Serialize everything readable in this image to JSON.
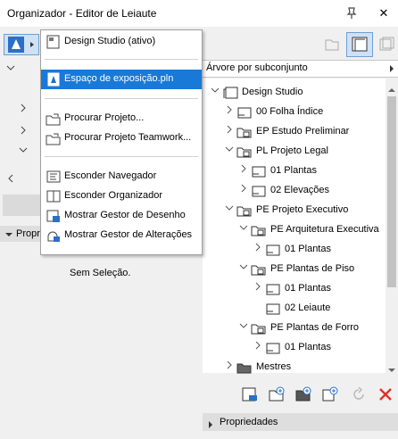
{
  "window": {
    "title": "Organizador - Editor de Leiaute",
    "close_glyph": "✕"
  },
  "menu": {
    "items": [
      {
        "label": "Design Studio (ativo)",
        "icon": "project-icon"
      },
      {
        "label": "Espaço de exposição.pln",
        "icon": "pln-file-icon",
        "selected": true
      },
      {
        "label": "Procurar Projeto...",
        "icon": "open-project-icon"
      },
      {
        "label": "Procurar Projeto Teamwork...",
        "icon": "open-teamwork-icon"
      },
      {
        "label": "Esconder Navegador",
        "icon": "navigator-icon"
      },
      {
        "label": "Esconder Organizador",
        "icon": "organizer-icon"
      },
      {
        "label": "Mostrar Gestor de Desenho",
        "icon": "drawing-manager-icon"
      },
      {
        "label": "Mostrar Gestor de Alterações",
        "icon": "change-manager-icon"
      }
    ]
  },
  "left_panel": {
    "properties_label": "Propr",
    "no_selection": "Sem Seleção."
  },
  "right_panel": {
    "tree_header": "Árvore por subconjunto",
    "tree": [
      {
        "label": "Design Studio",
        "depth": 0,
        "arrow": "down",
        "icon": "layout-book-icon"
      },
      {
        "label": "00 Folha Índice",
        "depth": 1,
        "arrow": "right",
        "icon": "layout-icon"
      },
      {
        "label": "EP Estudo Preliminar",
        "depth": 1,
        "arrow": "right",
        "icon": "subset-folder-icon"
      },
      {
        "label": "PL Projeto Legal",
        "depth": 1,
        "arrow": "down",
        "icon": "subset-folder-icon"
      },
      {
        "label": "01 Plantas",
        "depth": 2,
        "arrow": "right",
        "icon": "layout-icon"
      },
      {
        "label": "02 Elevações",
        "depth": 2,
        "arrow": "right",
        "icon": "layout-icon"
      },
      {
        "label": "PE Projeto Executivo",
        "depth": 1,
        "arrow": "down",
        "icon": "subset-folder-icon"
      },
      {
        "label": "PE Arquitetura Executiva",
        "depth": 2,
        "arrow": "down",
        "icon": "subset-folder-icon"
      },
      {
        "label": "01 Plantas",
        "depth": 3,
        "arrow": "right",
        "icon": "layout-icon"
      },
      {
        "label": "PE Plantas de Piso",
        "depth": 2,
        "arrow": "down",
        "icon": "subset-folder-icon"
      },
      {
        "label": "01 Plantas",
        "depth": 3,
        "arrow": "right",
        "icon": "layout-icon"
      },
      {
        "label": "02 Leiaute",
        "depth": 3,
        "arrow": "",
        "icon": "layout-icon"
      },
      {
        "label": "PE Plantas de Forro",
        "depth": 2,
        "arrow": "down",
        "icon": "subset-folder-icon"
      },
      {
        "label": "01 Plantas",
        "depth": 3,
        "arrow": "right",
        "icon": "layout-icon"
      },
      {
        "label": "Mestres",
        "depth": 1,
        "arrow": "right",
        "icon": "masters-folder-icon"
      }
    ],
    "properties_label": "Propriedades"
  },
  "colors": {
    "selection": "#1979d8",
    "accent": "#1f6fc5",
    "delete": "#e0302a"
  }
}
